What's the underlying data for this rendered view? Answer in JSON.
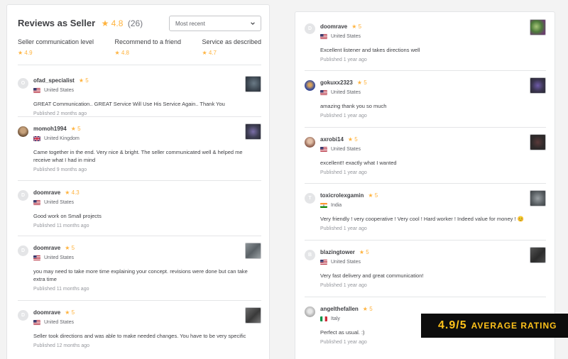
{
  "left": {
    "title": "Reviews as Seller",
    "rating": "★ 4.8",
    "count": "(26)",
    "sort": {
      "selected": "Most recent"
    },
    "breakdown": [
      {
        "label": "Seller communication level",
        "score": "★ 4.9"
      },
      {
        "label": "Recommend to a friend",
        "score": "★ 4.8"
      },
      {
        "label": "Service as described",
        "score": "★ 4.7"
      }
    ],
    "reviews": [
      {
        "user": "ofad_specialist",
        "avatar": "O",
        "stars": "★ 5",
        "country": "United States",
        "text": "GREAT Communication.. GREAT Service Will Use His Service Again.. Thank You",
        "date": "Published 2 months ago"
      },
      {
        "user": "momoh1994",
        "avatar": "",
        "stars": "★ 5",
        "country": "United Kingdom",
        "text": "Came together in the end. Very nice & bright. The seller communicated well & helped me receive what I had in mind",
        "date": "Published 9 months ago"
      },
      {
        "user": "doomrave",
        "avatar": "D",
        "stars": "★ 4.3",
        "country": "United States",
        "text": "Good work on Small projects",
        "date": "Published 11 months ago"
      },
      {
        "user": "doomrave",
        "avatar": "D",
        "stars": "★ 5",
        "country": "United States",
        "text": "you may need to take more time explaining your concept. revisions were done but can take extra time",
        "date": "Published 11 months ago"
      },
      {
        "user": "doomrave",
        "avatar": "D",
        "stars": "★ 5",
        "country": "United States",
        "text": "Seller took directions and was able to make needed changes. You have to be very specific",
        "date": "Published 12 months ago"
      }
    ]
  },
  "right": {
    "reviews": [
      {
        "user": "doomrave",
        "avatar": "D",
        "stars": "★ 5",
        "country": "United States",
        "text": "Excellent listener and takes directions well",
        "date": "Published 1 year ago"
      },
      {
        "user": "gokuxx2323",
        "avatar": "",
        "stars": "★ 5",
        "country": "United States",
        "text": "amazing thank you so much",
        "date": "Published 1 year ago"
      },
      {
        "user": "axrobi14",
        "avatar": "",
        "stars": "★ 5",
        "country": "United States",
        "text": "excellent!! exactly what I wanted",
        "date": "Published 1 year ago"
      },
      {
        "user": "toxicrolexgamin",
        "avatar": "T",
        "stars": "★ 5",
        "country": "India",
        "text": "Very friendly ! very cooperative ! Very cool ! Hard worker ! Indeed value for money ! 😊",
        "date": "Published 1 year ago"
      },
      {
        "user": "blazingtower",
        "avatar": "B",
        "stars": "★ 5",
        "country": "United States",
        "text": "Very fast delivery and great communication!",
        "date": "Published 1 year ago"
      },
      {
        "user": "angelthefallen",
        "avatar": "",
        "stars": "★ 5",
        "country": "Italy",
        "text": "Perfect as usual. :)",
        "date": "Published 1 year ago"
      }
    ]
  },
  "badge": {
    "value": "4.9/5",
    "label": "AVERAGE RATING"
  },
  "colors": {
    "star": "#ffb33e",
    "badge_bg": "#0d0d0d",
    "badge_text": "#ffc21a"
  }
}
